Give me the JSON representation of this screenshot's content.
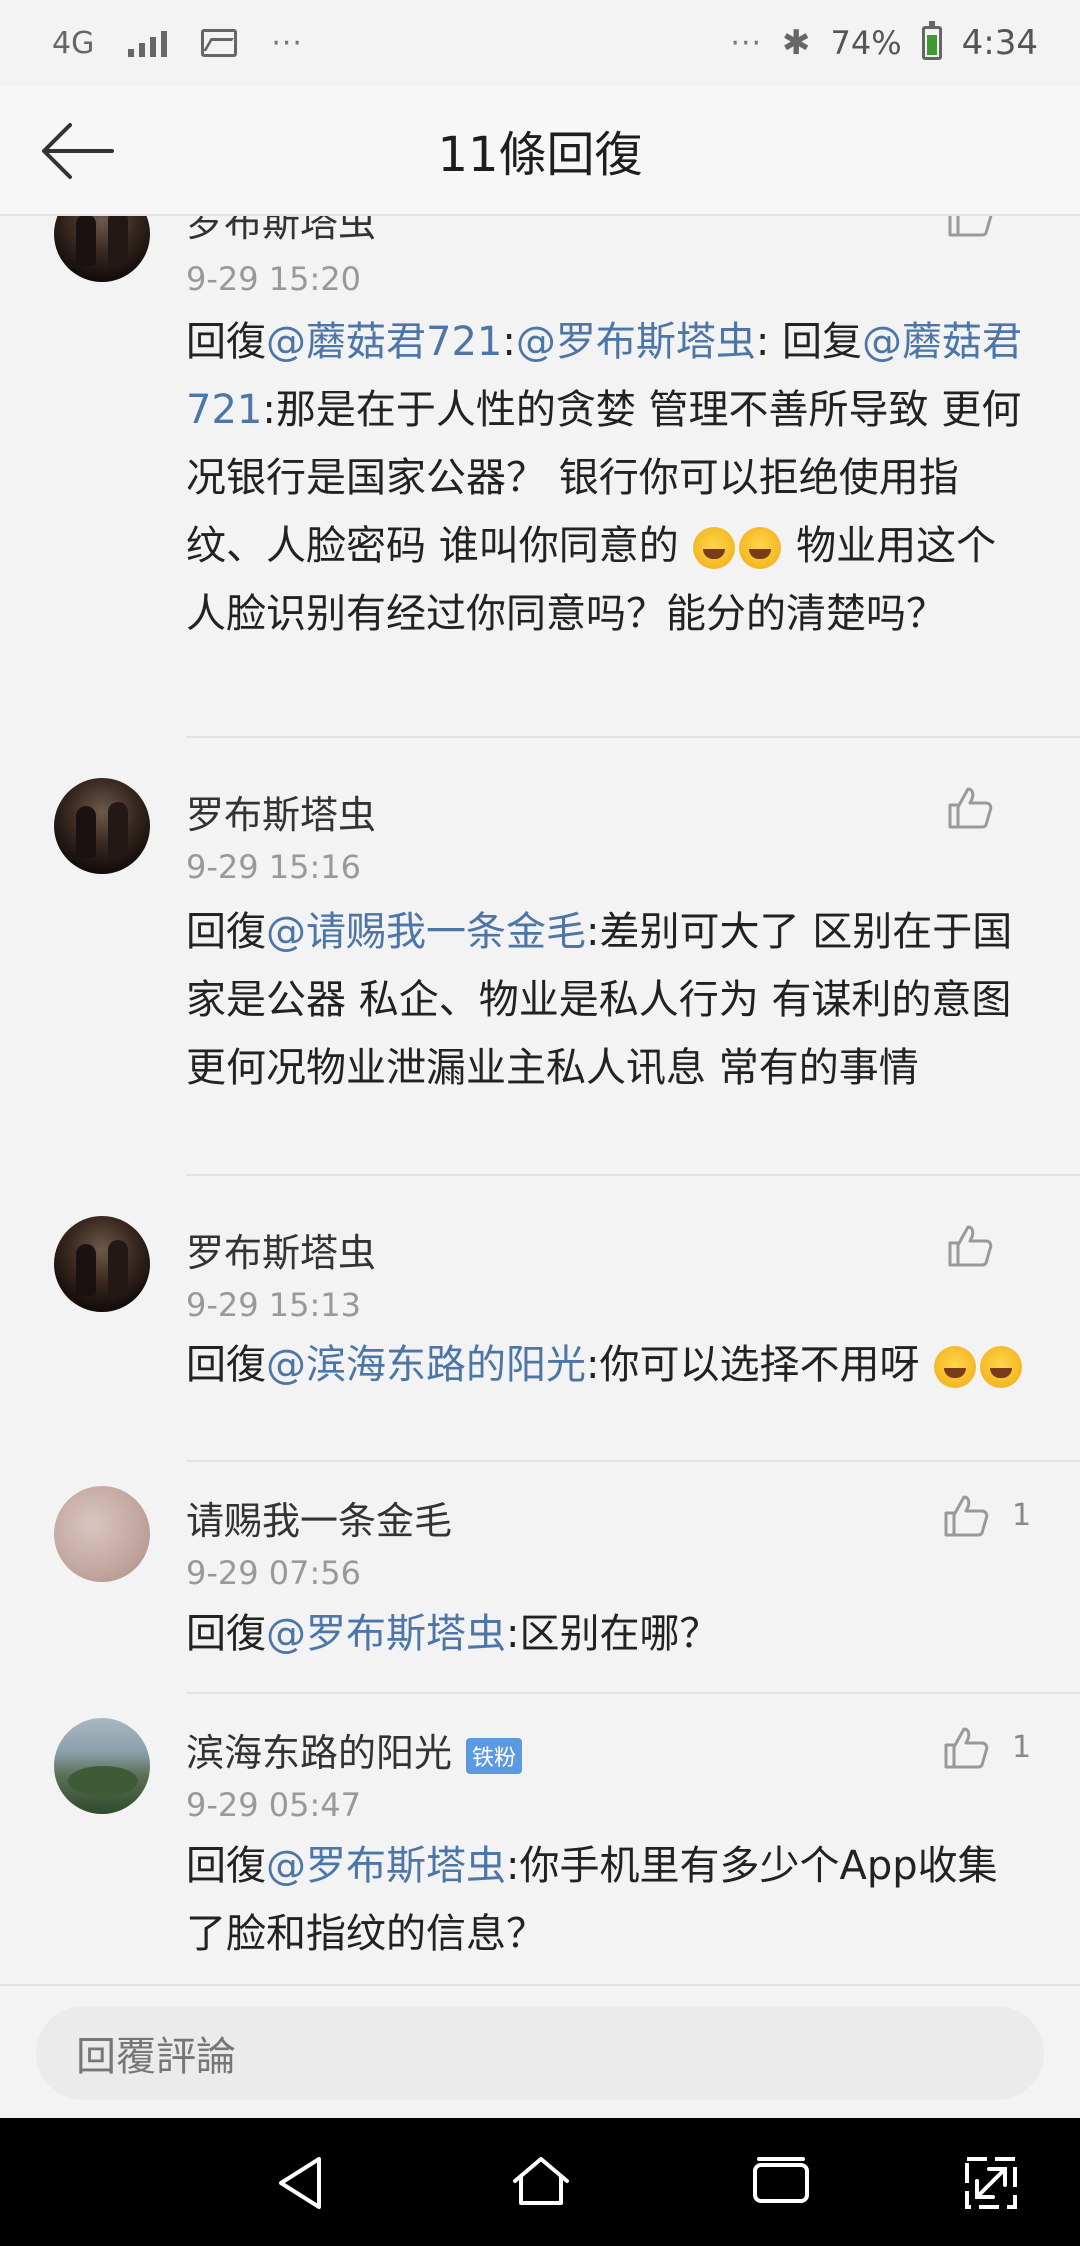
{
  "status_bar": {
    "network": "4G",
    "dots_left": "···",
    "dots_right": "···",
    "bluetooth": "✱",
    "battery_percent": "74%",
    "time": "4:34",
    "battery_level": 0.74,
    "battery_color": "#3c9a2f"
  },
  "header": {
    "title": "11條回復",
    "back_icon": "arrow-left-icon"
  },
  "colors": {
    "mention": "#4c76a8",
    "badge": "#5b9ae0",
    "background": "#f3f3f3"
  },
  "comments": [
    {
      "username": "罗布斯塔虫",
      "time": "9-29 15:20",
      "parts": [
        {
          "t": "回復"
        },
        {
          "t": "@蘑菇君721",
          "m": true
        },
        {
          "t": ":"
        },
        {
          "t": "@罗布斯塔虫",
          "m": true
        },
        {
          "t": ": 回复"
        },
        {
          "t": "@蘑菇君721",
          "m": true
        },
        {
          "t": ":那是在于人性的贪婪 管理不善所导致 更何况银行是国家公器？ 银行你可以拒绝使用指纹、人脸密码 谁叫你同意的 "
        },
        {
          "e": "laugh-tears-emoji"
        },
        {
          "e": "laugh-tears-emoji"
        },
        {
          "t": " 物业用这个人脸识别有经过你同意吗？能分的清楚吗？"
        }
      ],
      "likes": ""
    },
    {
      "username": "罗布斯塔虫",
      "time": "9-29 15:16",
      "parts": [
        {
          "t": "回復"
        },
        {
          "t": "@请赐我一条金毛",
          "m": true
        },
        {
          "t": ":差别可大了 区别在于国家是公器 私企、物业是私人行为 有谋利的意图 更何况物业泄漏业主私人讯息 常有的事情"
        }
      ],
      "likes": ""
    },
    {
      "username": "罗布斯塔虫",
      "time": "9-29 15:13",
      "parts": [
        {
          "t": "回復"
        },
        {
          "t": "@滨海东路的阳光",
          "m": true
        },
        {
          "t": ":你可以选择不用呀 "
        },
        {
          "e": "rofl-emoji"
        },
        {
          "e": "rofl-emoji"
        }
      ],
      "likes": ""
    },
    {
      "username": "请赐我一条金毛",
      "time": "9-29 07:56",
      "parts": [
        {
          "t": "回復"
        },
        {
          "t": "@罗布斯塔虫",
          "m": true
        },
        {
          "t": ":区别在哪？"
        }
      ],
      "likes": "1"
    },
    {
      "username": "滨海东路的阳光",
      "badge": "铁粉",
      "time": "9-29 05:47",
      "parts": [
        {
          "t": "回復"
        },
        {
          "t": "@罗布斯塔虫",
          "m": true
        },
        {
          "t": ":你手机里有多少个App收集了脸和指纹的信息？"
        }
      ],
      "likes": "1"
    }
  ],
  "reply_input": {
    "placeholder": "回覆評論"
  },
  "nav_bar": {
    "buttons": [
      "back-triangle-icon",
      "home-icon",
      "recents-icon",
      "expand-icon"
    ]
  }
}
